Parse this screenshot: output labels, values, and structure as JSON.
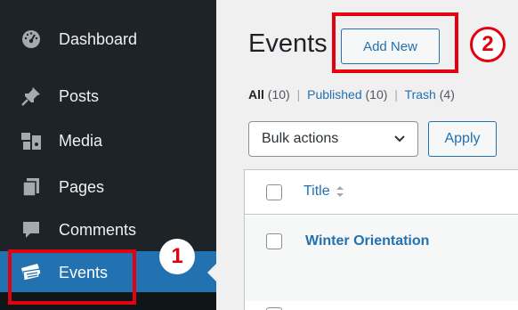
{
  "sidebar": {
    "items": [
      {
        "label": "Dashboard",
        "icon": "dashboard-icon"
      },
      {
        "label": "Posts",
        "icon": "pin-icon"
      },
      {
        "label": "Media",
        "icon": "media-icon"
      },
      {
        "label": "Pages",
        "icon": "pages-icon"
      },
      {
        "label": "Comments",
        "icon": "comments-icon"
      },
      {
        "label": "Events",
        "icon": "tickets-icon",
        "active": true
      }
    ]
  },
  "header": {
    "title": "Events",
    "add_new_label": "Add New"
  },
  "filters": {
    "all": "All",
    "all_count": "(10)",
    "published": "Published",
    "published_count": "(10)",
    "trash": "Trash",
    "trash_count": "(4)",
    "separator": "|"
  },
  "bulk": {
    "selected": "Bulk actions",
    "apply_label": "Apply"
  },
  "table": {
    "columns": [
      "Title"
    ],
    "rows": [
      {
        "title": "Winter Orientation"
      }
    ]
  },
  "annotations": {
    "step1": "1",
    "step2": "2",
    "color": "#e3000f"
  },
  "colors": {
    "sidebar_bg": "#1d2327",
    "active_bg": "#2271b1",
    "link": "#2271b1"
  }
}
